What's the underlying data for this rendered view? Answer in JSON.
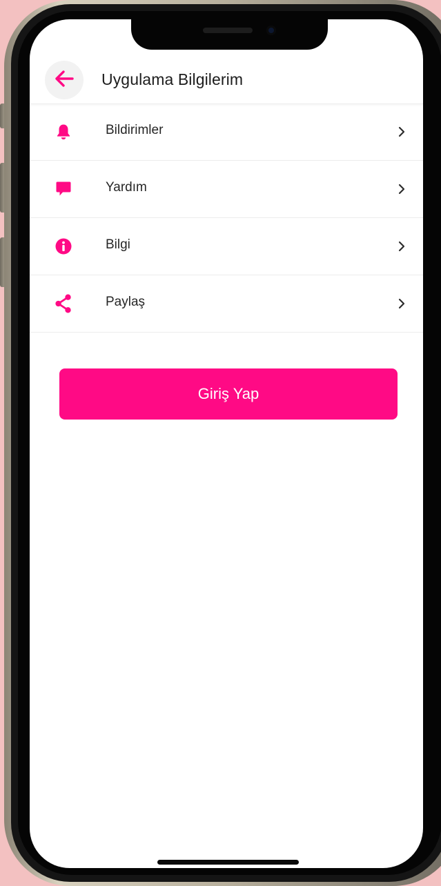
{
  "header": {
    "title": "Uygulama Bilgilerim",
    "back_icon": "arrow-left-icon"
  },
  "menu": {
    "items": [
      {
        "label": "Bildirimler",
        "icon": "bell-icon"
      },
      {
        "label": "Yardım",
        "icon": "chat-bubble-icon"
      },
      {
        "label": "Bilgi",
        "icon": "info-icon"
      },
      {
        "label": "Paylaş",
        "icon": "share-icon"
      }
    ],
    "chevron_icon": "chevron-right-icon"
  },
  "login_button": {
    "label": "Giriş Yap"
  },
  "colors": {
    "accent": "#ff0a85",
    "background": "#f3c1c1",
    "text": "#262626"
  }
}
